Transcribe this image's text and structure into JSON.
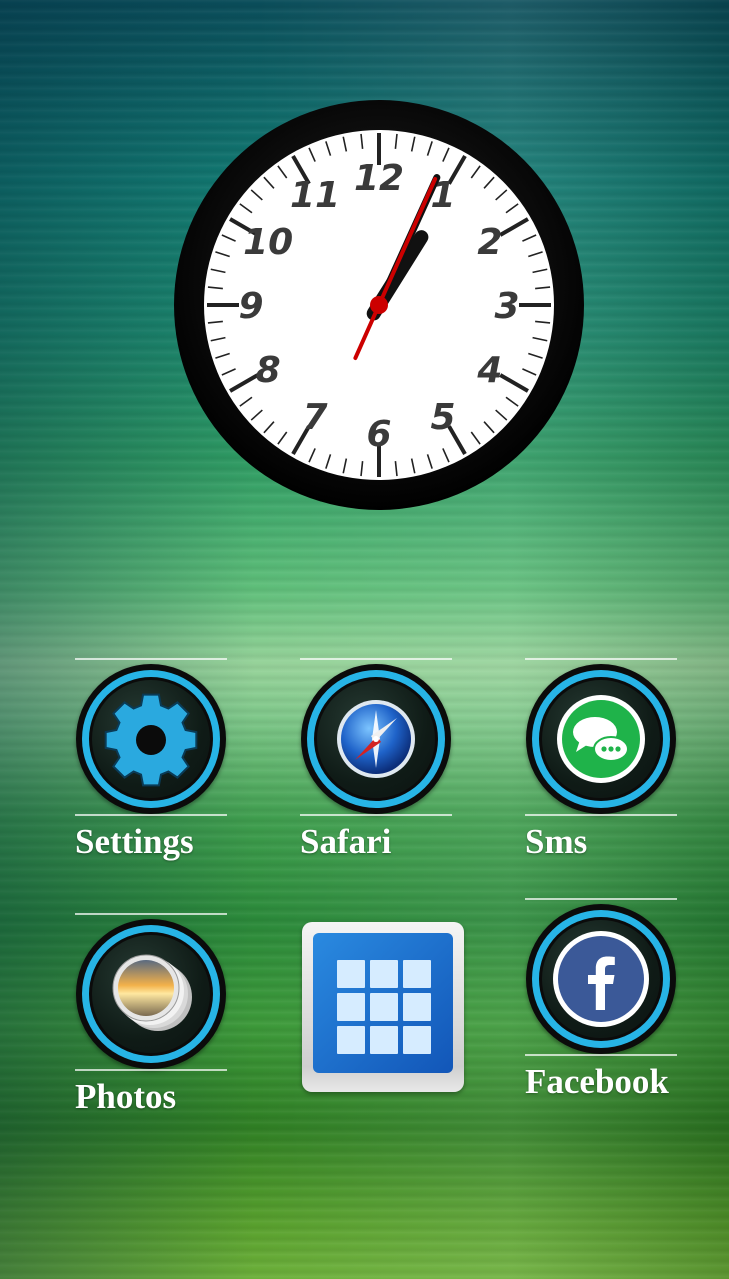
{
  "clock": {
    "numerals": [
      "12",
      "1",
      "2",
      "3",
      "4",
      "5",
      "6",
      "7",
      "8",
      "9",
      "10",
      "11"
    ],
    "time": {
      "hour": 1,
      "minute": 4,
      "second": 4
    },
    "colors": {
      "bezel": "#0b0b0b",
      "face": "#ffffff",
      "second_hand": "#cc0000"
    }
  },
  "apps": [
    {
      "id": "settings",
      "label": "Settings",
      "icon": "gear-icon"
    },
    {
      "id": "safari",
      "label": "Safari",
      "icon": "compass-icon"
    },
    {
      "id": "sms",
      "label": "Sms",
      "icon": "message-bubble-icon"
    },
    {
      "id": "photos",
      "label": "Photos",
      "icon": "photos-stack-icon"
    },
    {
      "id": "app-drawer",
      "label": "",
      "icon": "grid-icon"
    },
    {
      "id": "facebook",
      "label": "Facebook",
      "icon": "facebook-icon"
    }
  ],
  "colors": {
    "ring_accent": "#27b4e6",
    "label_text": "#ffffff"
  }
}
